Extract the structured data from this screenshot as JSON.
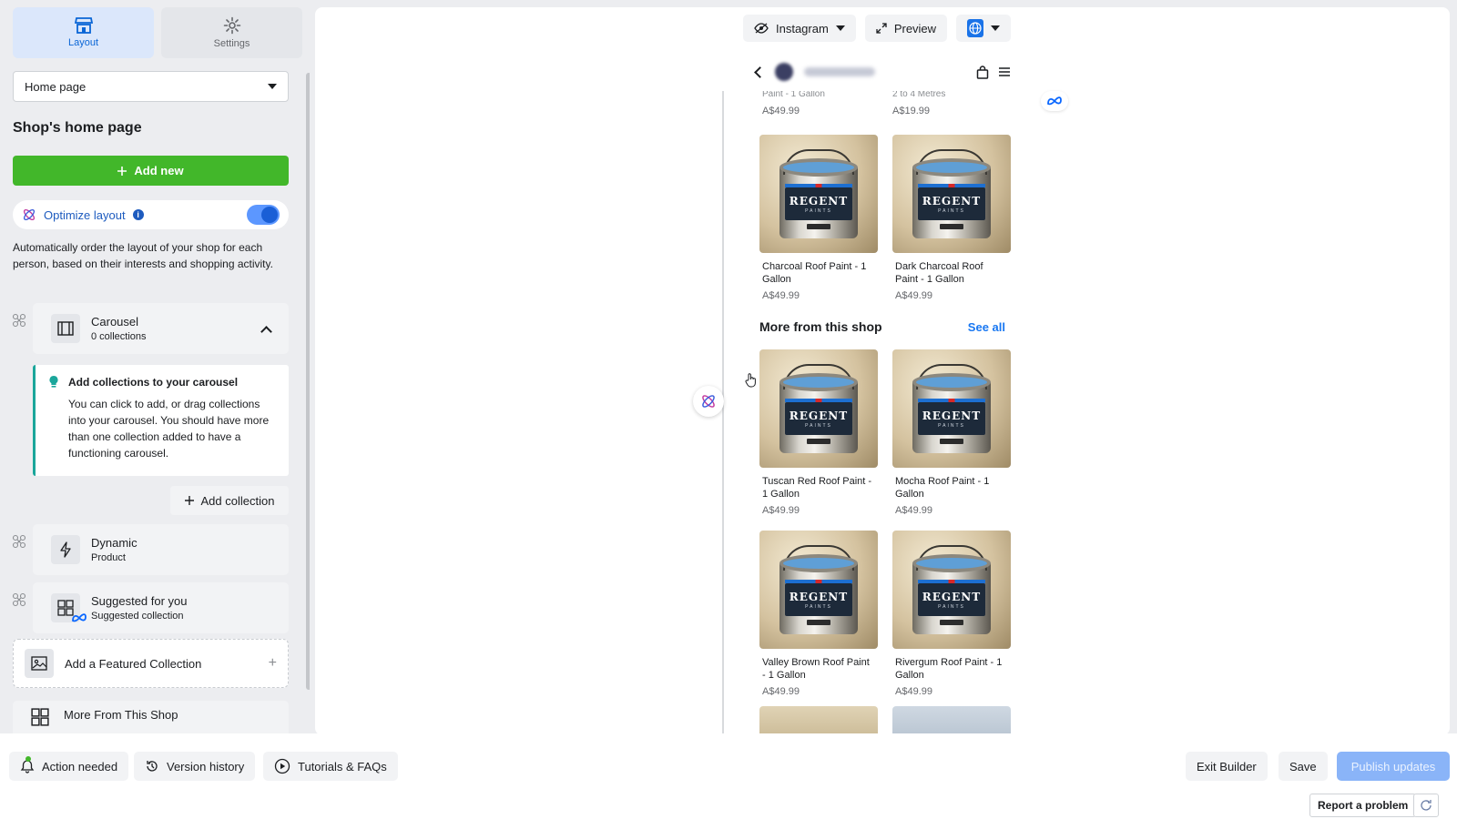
{
  "tabs": [
    {
      "label": "Layout",
      "icon": "storefront-icon",
      "active": true
    },
    {
      "label": "Settings",
      "icon": "gear-icon",
      "active": false
    }
  ],
  "page_select": {
    "value": "Home page"
  },
  "sidebar_title": "Shop's home page",
  "add_new_label": "Add new",
  "optimize": {
    "label": "Optimize layout",
    "enabled": true,
    "description": "Automatically order the layout of your shop for each person, based on their interests and shopping activity."
  },
  "carousel": {
    "title": "Carousel",
    "subtitle": "0 collections",
    "hint_title": "Add collections to your carousel",
    "hint_body": "You can click to add, or drag collections into your carousel. You should have more than one collection added to have a functioning carousel.",
    "add_collection_label": "Add collection"
  },
  "dynamic": {
    "title": "Dynamic",
    "subtitle": "Product"
  },
  "suggested": {
    "title": "Suggested for you",
    "subtitle": "Suggested collection"
  },
  "featured_label": "Add a Featured Collection",
  "more_from_shop_label": "More From This Shop",
  "toolbar": {
    "platform": "Instagram",
    "preview": "Preview"
  },
  "preview": {
    "top_prices": [
      "A$49.99",
      "A$19.99"
    ],
    "top_partial_names": [
      "Paint - 1 Gallon",
      "2 to 4 Metres"
    ],
    "products_top": [
      {
        "name": "Charcoal Roof Paint - 1 Gallon",
        "price": "A$49.99"
      },
      {
        "name": "Dark Charcoal Roof Paint - 1 Gallon",
        "price": "A$49.99"
      }
    ],
    "section_title": "More from this shop",
    "see_all": "See all",
    "products_more": [
      {
        "name": "Tuscan Red Roof Paint - 1 Gallon",
        "price": "A$49.99"
      },
      {
        "name": "Mocha Roof Paint - 1 Gallon",
        "price": "A$49.99"
      },
      {
        "name": "Valley Brown Roof Paint - 1 Gallon",
        "price": "A$49.99"
      },
      {
        "name": "Rivergum Roof Paint - 1 Gallon",
        "price": "A$49.99"
      }
    ],
    "brand": "REGENT",
    "brand_sub": "PAINTS"
  },
  "bottom": {
    "action_needed": "Action needed",
    "version_history": "Version history",
    "tutorials": "Tutorials & FAQs",
    "exit_builder": "Exit Builder",
    "save": "Save",
    "publish": "Publish updates",
    "report": "Report a problem"
  },
  "colors": {
    "primary": "#1877f2",
    "add_new": "#42b72a",
    "hint_accent": "#1aa69b",
    "publish_disabled": "#8ab4f8"
  }
}
